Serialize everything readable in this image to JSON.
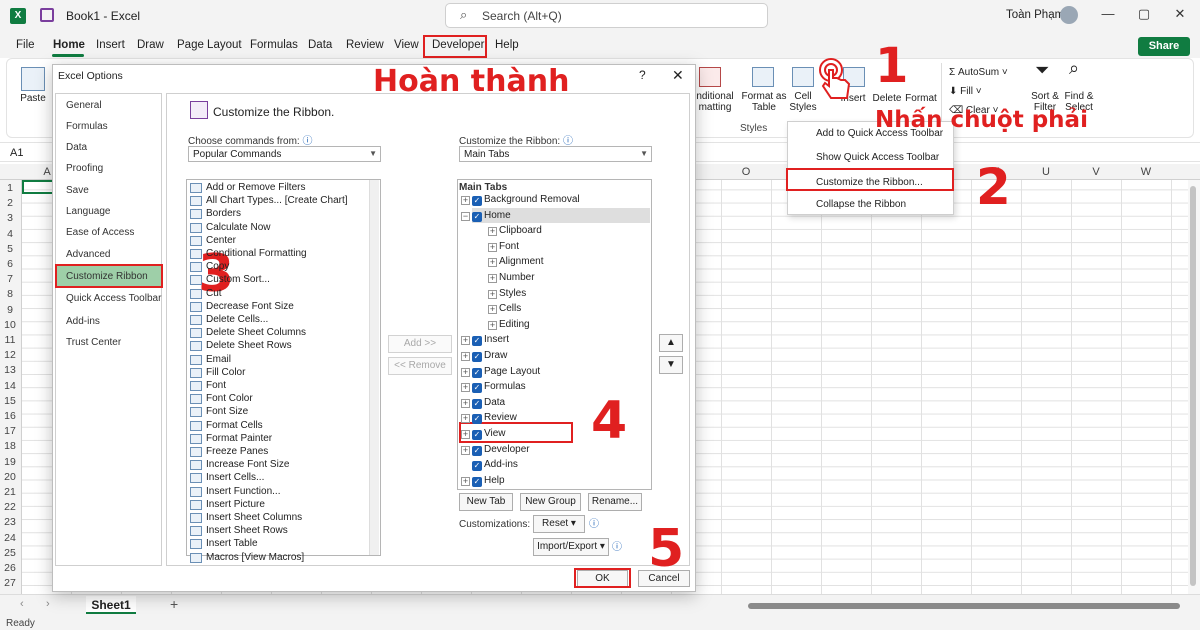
{
  "titlebar": {
    "app_icon": "excel-logo",
    "book_title": "Book1  -  Excel",
    "search_placeholder": "Search (Alt+Q)",
    "user_name": "Toàn Phạm",
    "min": "—",
    "max": "▢",
    "close": "✕"
  },
  "menu": {
    "items": [
      "File",
      "Home",
      "Insert",
      "Draw",
      "Page Layout",
      "Formulas",
      "Data",
      "Review",
      "View",
      "Developer",
      "Help"
    ],
    "share": "Share"
  },
  "ribbon": {
    "paste": "Paste",
    "conditional": "nditional\nmatting",
    "format_as_table": "Format as\nTable",
    "cell_styles": "Cell\nStyles",
    "insert": "Insert",
    "delete": "Delete",
    "format": "Format",
    "autosum": "AutoSum",
    "fill": "Fill",
    "clear": "Clear",
    "sort_filter": "Sort &\nFilter",
    "find_select": "Find &\nSelect",
    "styles_group": "Styles"
  },
  "namebox": "A1",
  "columns": [
    "A",
    "O",
    "P",
    "Q",
    "R",
    "S",
    "T",
    "U",
    "V",
    "W"
  ],
  "rows": [
    "1",
    "2",
    "3",
    "4",
    "5",
    "6",
    "7",
    "8",
    "9",
    "10",
    "11",
    "12",
    "13",
    "14",
    "15",
    "16",
    "17",
    "18",
    "19",
    "20",
    "21",
    "22",
    "23",
    "24",
    "25",
    "26",
    "27"
  ],
  "sheet_tab": "Sheet1",
  "status": "Ready",
  "context_menu": {
    "items": [
      "Add to Quick Access Toolbar",
      "Show Quick Access Toolbar",
      "Customize the Ribbon...",
      "Collapse the Ribbon"
    ]
  },
  "dialog": {
    "title": "Excel Options",
    "help": "?",
    "close": "✕",
    "nav": [
      "General",
      "Formulas",
      "Data",
      "Proofing",
      "Save",
      "Language",
      "Ease of Access",
      "Advanced",
      "Customize Ribbon",
      "Quick Access Toolbar",
      "Add-ins",
      "Trust Center"
    ],
    "section_title": "Customize the Ribbon.",
    "choose_label": "Choose commands from:",
    "choose_value": "Popular Commands",
    "customize_label": "Customize the Ribbon:",
    "customize_value": "Main Tabs",
    "commands": [
      "Add or Remove Filters",
      "All Chart Types... [Create Chart]",
      "Borders",
      "Calculate Now",
      "Center",
      "Conditional Formatting",
      "Copy",
      "Custom Sort...",
      "Cut",
      "Decrease Font Size",
      "Delete Cells...",
      "Delete Sheet Columns",
      "Delete Sheet Rows",
      "Email",
      "Fill Color",
      "Font",
      "Font Color",
      "Font Size",
      "Format Cells",
      "Format Painter",
      "Freeze Panes",
      "Increase Font Size",
      "Insert Cells...",
      "Insert Function...",
      "Insert Picture",
      "Insert Sheet Columns",
      "Insert Sheet Rows",
      "Insert Table",
      "Macros [View Macros]"
    ],
    "add_btn": "Add >>",
    "remove_btn": "<< Remove",
    "tree_header": "Main Tabs",
    "tree": [
      "Background Removal",
      "Home",
      "Clipboard",
      "Font",
      "Alignment",
      "Number",
      "Styles",
      "Cells",
      "Editing",
      "Insert",
      "Draw",
      "Page Layout",
      "Formulas",
      "Data",
      "Review",
      "View",
      "Developer",
      "Add-ins",
      "Help"
    ],
    "new_tab": "New Tab",
    "new_group": "New Group",
    "rename": "Rename...",
    "customizations_label": "Customizations:",
    "reset": "Reset",
    "import_export": "Import/Export",
    "ok": "OK",
    "cancel": "Cancel"
  },
  "annotations": {
    "done": "Hoàn thành",
    "right_click": "Nhấn chuột phải",
    "step1": "1",
    "step2": "2",
    "step3": "3",
    "step4": "4",
    "step5": "5"
  },
  "colors": {
    "excel_green": "#107c41",
    "annotation_red": "#e02020",
    "checkbox_blue": "#1a5fb4",
    "nav_selected": "#9ecfa8"
  }
}
